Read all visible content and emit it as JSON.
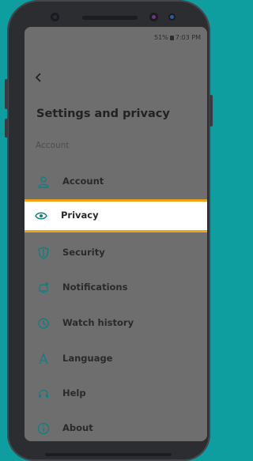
{
  "status_bar": {
    "battery": "51%",
    "time": "7:03 PM"
  },
  "header": {
    "title": "Settings and privacy"
  },
  "section": {
    "label": "Account"
  },
  "menu": [
    {
      "label": "Account",
      "icon": "person-icon"
    },
    {
      "label": "Privacy",
      "icon": "eye-icon"
    },
    {
      "label": "Security",
      "icon": "shield-icon"
    },
    {
      "label": "Notifications",
      "icon": "bell-icon"
    },
    {
      "label": "Watch history",
      "icon": "history-icon"
    },
    {
      "label": "Language",
      "icon": "language-icon"
    },
    {
      "label": "Help",
      "icon": "headset-icon"
    },
    {
      "label": "About",
      "icon": "info-icon"
    }
  ],
  "colors": {
    "accent": "#f3a316",
    "icon": "#0f7f82",
    "background": "#0f9ea0"
  }
}
